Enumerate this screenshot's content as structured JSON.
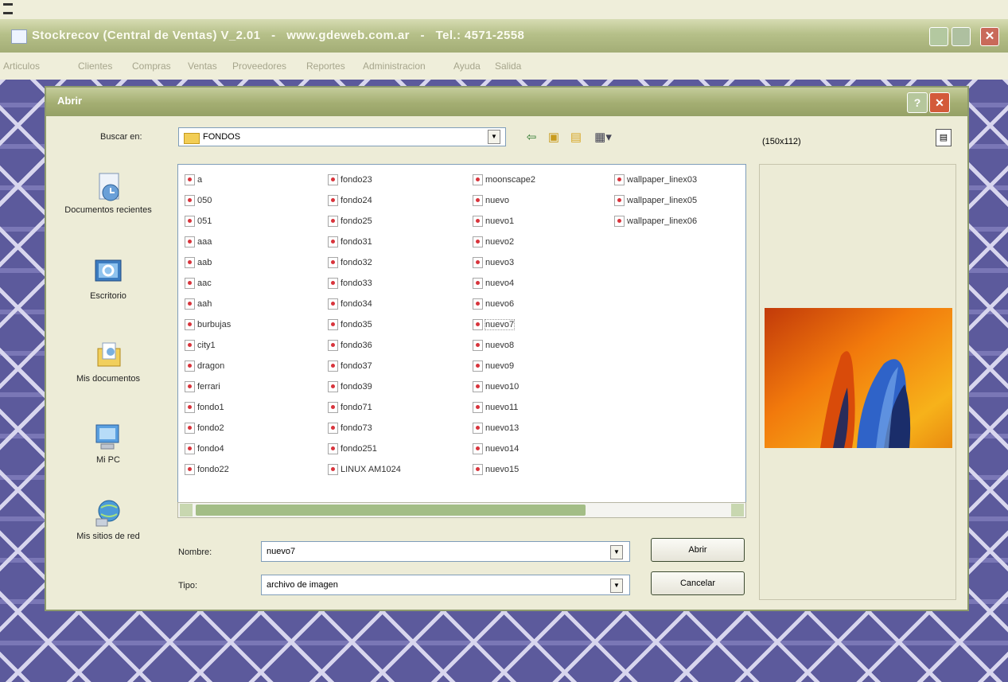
{
  "app": {
    "title": "Stockrecov (Central de Ventas) V_2.01   -   www.gdeweb.com.ar   -   Tel.: 4571-2558",
    "menu": [
      "Articulos",
      "Clientes",
      "Compras",
      "Ventas",
      "Proveedores",
      "Reportes",
      "Administracion",
      "Ayuda",
      "Salida"
    ]
  },
  "dialog": {
    "title": "Abrir",
    "look_in_label": "Buscar en:",
    "look_in_value": "FONDOS",
    "places": [
      {
        "label": "Documentos recientes",
        "icon": "recent-documents-icon"
      },
      {
        "label": "Escritorio",
        "icon": "desktop-icon"
      },
      {
        "label": "Mis documentos",
        "icon": "my-documents-icon"
      },
      {
        "label": "Mi PC",
        "icon": "my-computer-icon"
      },
      {
        "label": "Mis sitios de red",
        "icon": "network-places-icon"
      }
    ],
    "file_columns": [
      [
        "a",
        "050",
        "051",
        "aaa",
        "aab",
        "aac",
        "aah",
        "burbujas",
        "city1",
        "dragon",
        "ferrari",
        "fondo1",
        "fondo2",
        "fondo4",
        "fondo22"
      ],
      [
        "fondo23",
        "fondo24",
        "fondo25",
        "fondo31",
        "fondo32",
        "fondo33",
        "fondo34",
        "fondo35",
        "fondo36",
        "fondo37",
        "fondo39",
        "fondo71",
        "fondo73",
        "fondo251",
        "LINUX AM1024"
      ],
      [
        "moonscape2",
        "nuevo",
        "nuevo1",
        "nuevo2",
        "nuevo3",
        "nuevo4",
        "nuevo6",
        "nuevo7",
        "nuevo8",
        "nuevo9",
        "nuevo10",
        "nuevo11",
        "nuevo13",
        "nuevo14",
        "nuevo15"
      ],
      [
        "wallpaper_linex03",
        "wallpaper_linex05",
        "wallpaper_linex06"
      ]
    ],
    "selected_file": "nuevo7",
    "filename_label": "Nombre:",
    "filename_value": "nuevo7",
    "type_label": "Tipo:",
    "type_value": "archivo de imagen",
    "open_button": "Abrir",
    "cancel_button": "Cancelar",
    "preview_size": "(150x112)"
  }
}
